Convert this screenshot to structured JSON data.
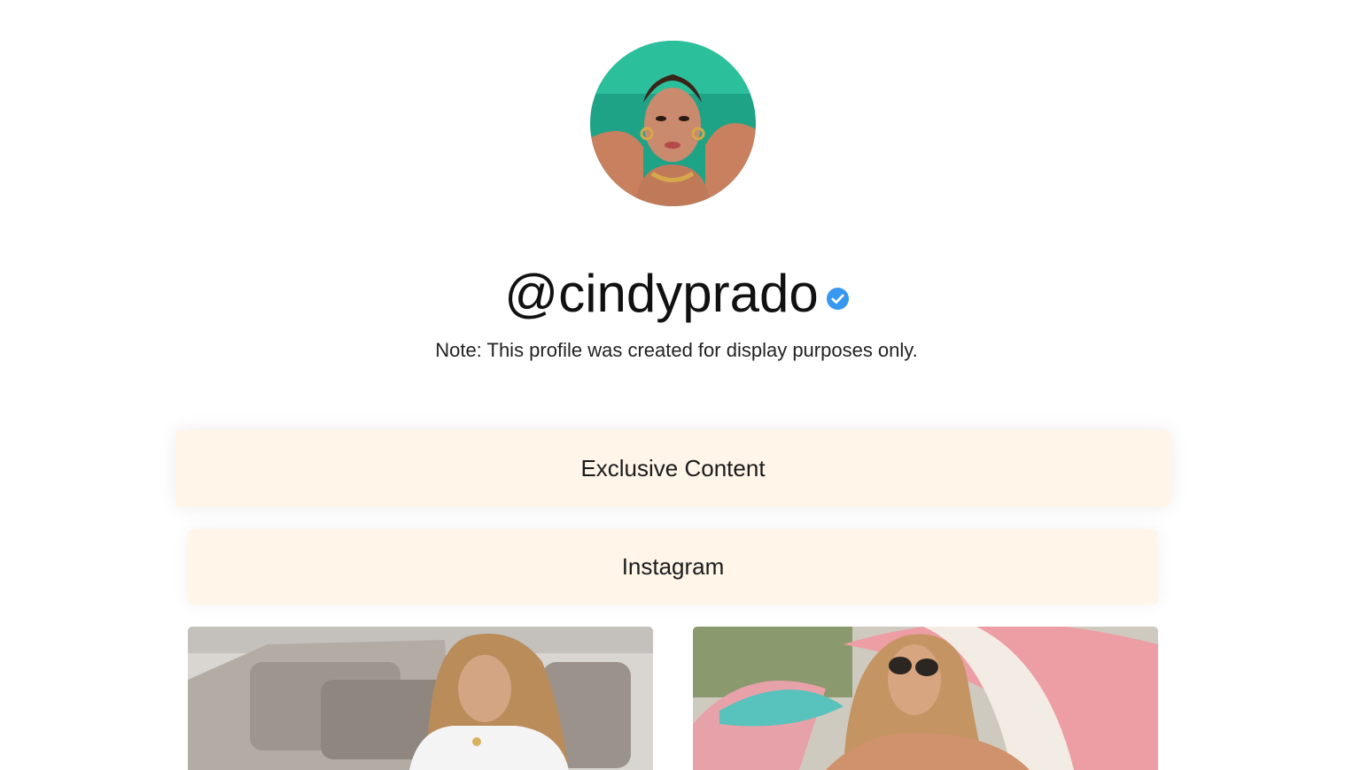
{
  "profile": {
    "handle": "@cindyprado",
    "verified": true,
    "note": "Note: This profile was created for display purposes only."
  },
  "links": [
    {
      "label": "Exclusive Content"
    },
    {
      "label": "Instagram"
    }
  ],
  "media": [
    {
      "name": "photo-couch"
    },
    {
      "name": "photo-beach-umbrella"
    }
  ],
  "colors": {
    "button_bg": "#fff5e8",
    "verified_blue": "#3897f0",
    "text": "#111111"
  }
}
